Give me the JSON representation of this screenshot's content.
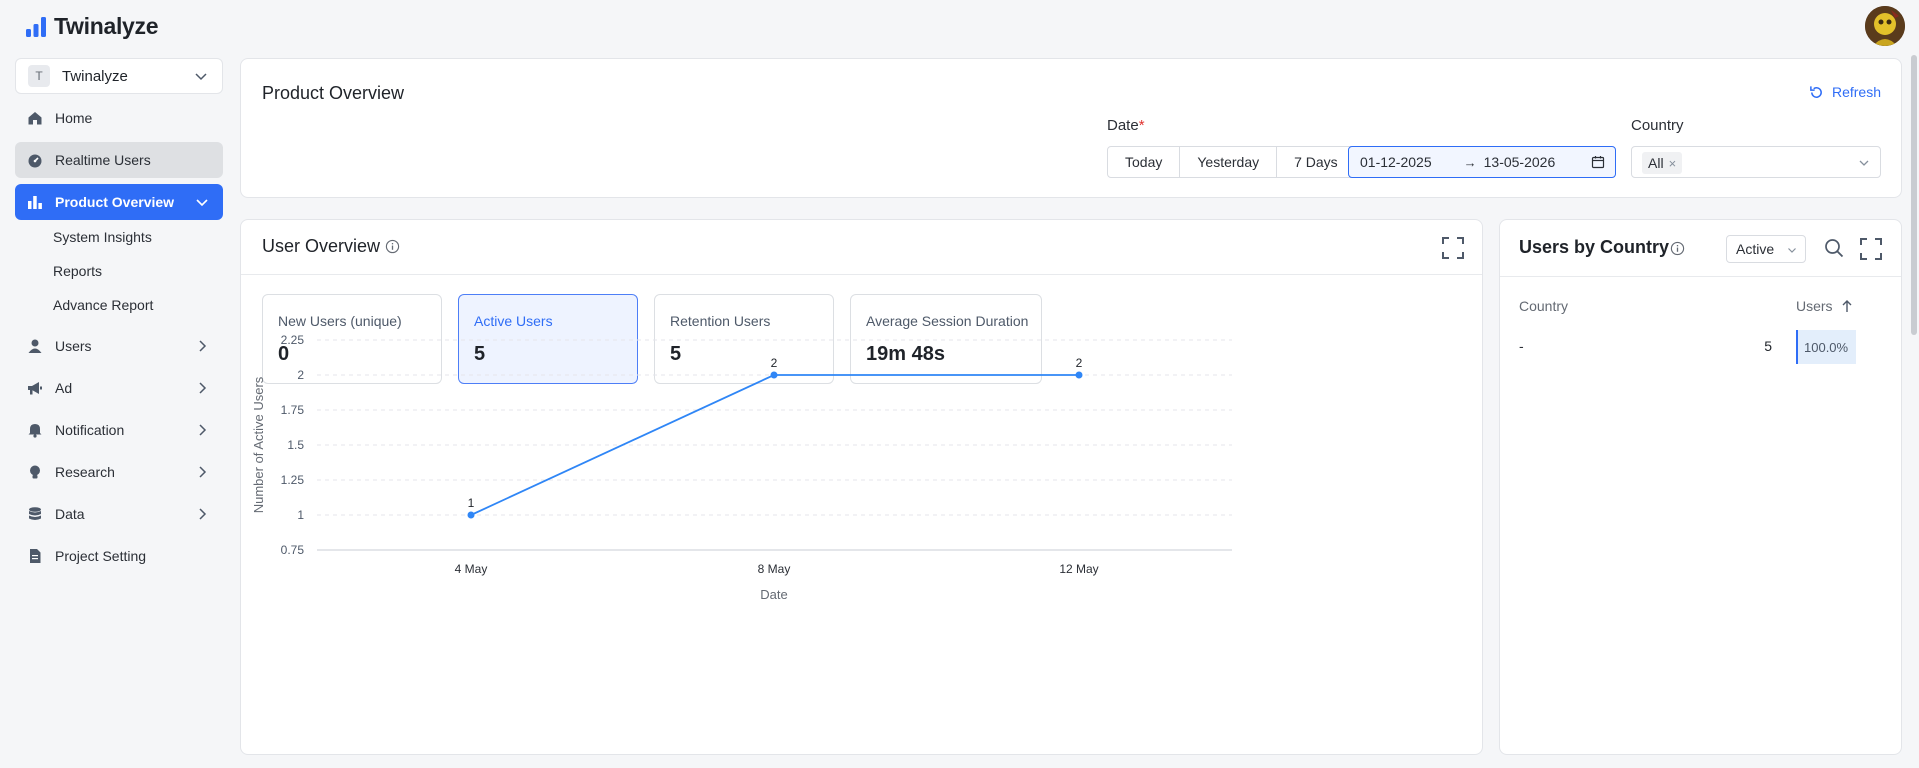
{
  "app": {
    "name": "Twinalyze"
  },
  "sidebar": {
    "org": {
      "badge": "T",
      "name": "Twinalyze"
    },
    "items": [
      {
        "label": "Home",
        "icon": "home-icon"
      },
      {
        "label": "Realtime Users",
        "icon": "gauge-icon"
      },
      {
        "label": "Product Overview",
        "icon": "bar-chart-icon"
      },
      {
        "label": "Users",
        "icon": "user-icon"
      },
      {
        "label": "Ad",
        "icon": "megaphone-icon"
      },
      {
        "label": "Notification",
        "icon": "bell-icon"
      },
      {
        "label": "Research",
        "icon": "bulb-icon"
      },
      {
        "label": "Data",
        "icon": "database-icon"
      },
      {
        "label": "Project Setting",
        "icon": "document-icon"
      }
    ],
    "sub_items": [
      "System Insights",
      "Reports",
      "Advance Report"
    ]
  },
  "filters": {
    "title": "Product Overview",
    "refresh_label": "Refresh",
    "date_label": "Date",
    "required_mark": "*",
    "quick_ranges": [
      "Today",
      "Yesterday",
      "7 Days"
    ],
    "date_from": "01-12-2025",
    "date_arrow": "→",
    "date_to": "13-05-2026",
    "country_label": "Country",
    "country_tag": "All",
    "tag_close": "×"
  },
  "overview": {
    "title": "User Overview",
    "metrics": [
      {
        "label": "New Users (unique)",
        "value": "0"
      },
      {
        "label": "Active Users",
        "value": "5"
      },
      {
        "label": "Retention Users",
        "value": "5"
      },
      {
        "label": "Average Session Duration",
        "value": "19m 48s"
      }
    ]
  },
  "chart_data": {
    "type": "line",
    "x": [
      "4 May",
      "8 May",
      "12 May"
    ],
    "series": [
      {
        "values": [
          1,
          2,
          2
        ]
      }
    ],
    "data_labels": [
      "1",
      "2",
      "2"
    ],
    "xlabel": "Date",
    "ylabel": "Number of Active Users",
    "ylim": [
      0.75,
      2.25
    ],
    "yticks": [
      "0.75",
      "1",
      "1.25",
      "1.5",
      "1.75",
      "2",
      "2.25"
    ],
    "grid": true,
    "color": "#2f86f6"
  },
  "country_card": {
    "title": "Users by Country",
    "metric_select": "Active",
    "col_country": "Country",
    "col_users": "Users",
    "rows": [
      {
        "country": "-",
        "users": "5",
        "share": "100.0%"
      }
    ]
  },
  "colors": {
    "accent": "#2f6df6",
    "line": "#2f86f6"
  }
}
